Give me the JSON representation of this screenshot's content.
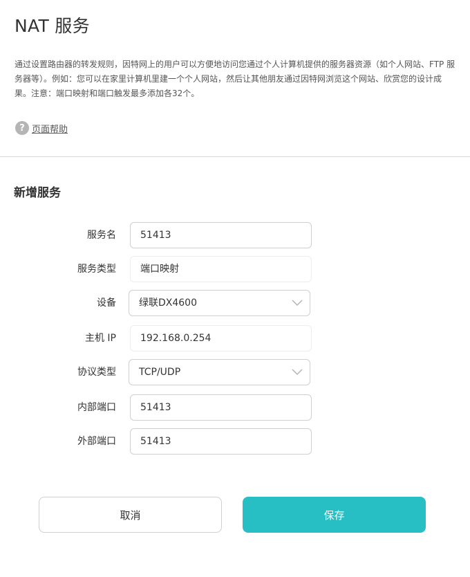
{
  "page": {
    "title": "NAT 服务",
    "description": "通过设置路由器的转发规则，因特网上的用户可以方便地访问您通过个人计算机提供的服务器资源（如个人网站、FTP 服务器等）。例如：您可以在家里计算机里建一个个人网站，然后让其他朋友通过因特网浏览这个网站、欣赏您的设计成果。注意：端口映射和端口触发最多添加各32个。",
    "help_icon_glyph": "?",
    "help_label": "页面帮助"
  },
  "form": {
    "section_title": "新增服务",
    "service_name": {
      "label": "服务名",
      "value": "51413"
    },
    "service_type": {
      "label": "服务类型",
      "value": "端口映射"
    },
    "device": {
      "label": "设备",
      "value": "绿联DX4600"
    },
    "host_ip": {
      "label": "主机 IP",
      "value": "192.168.0.254"
    },
    "protocol": {
      "label": "协议类型",
      "value": "TCP/UDP"
    },
    "internal_port": {
      "label": "内部端口",
      "value": "51413"
    },
    "external_port": {
      "label": "外部端口",
      "value": "51413"
    }
  },
  "actions": {
    "cancel_label": "取消",
    "save_label": "保存"
  },
  "colors": {
    "accent": "#27bfc4",
    "border": "#cfcfcf"
  }
}
